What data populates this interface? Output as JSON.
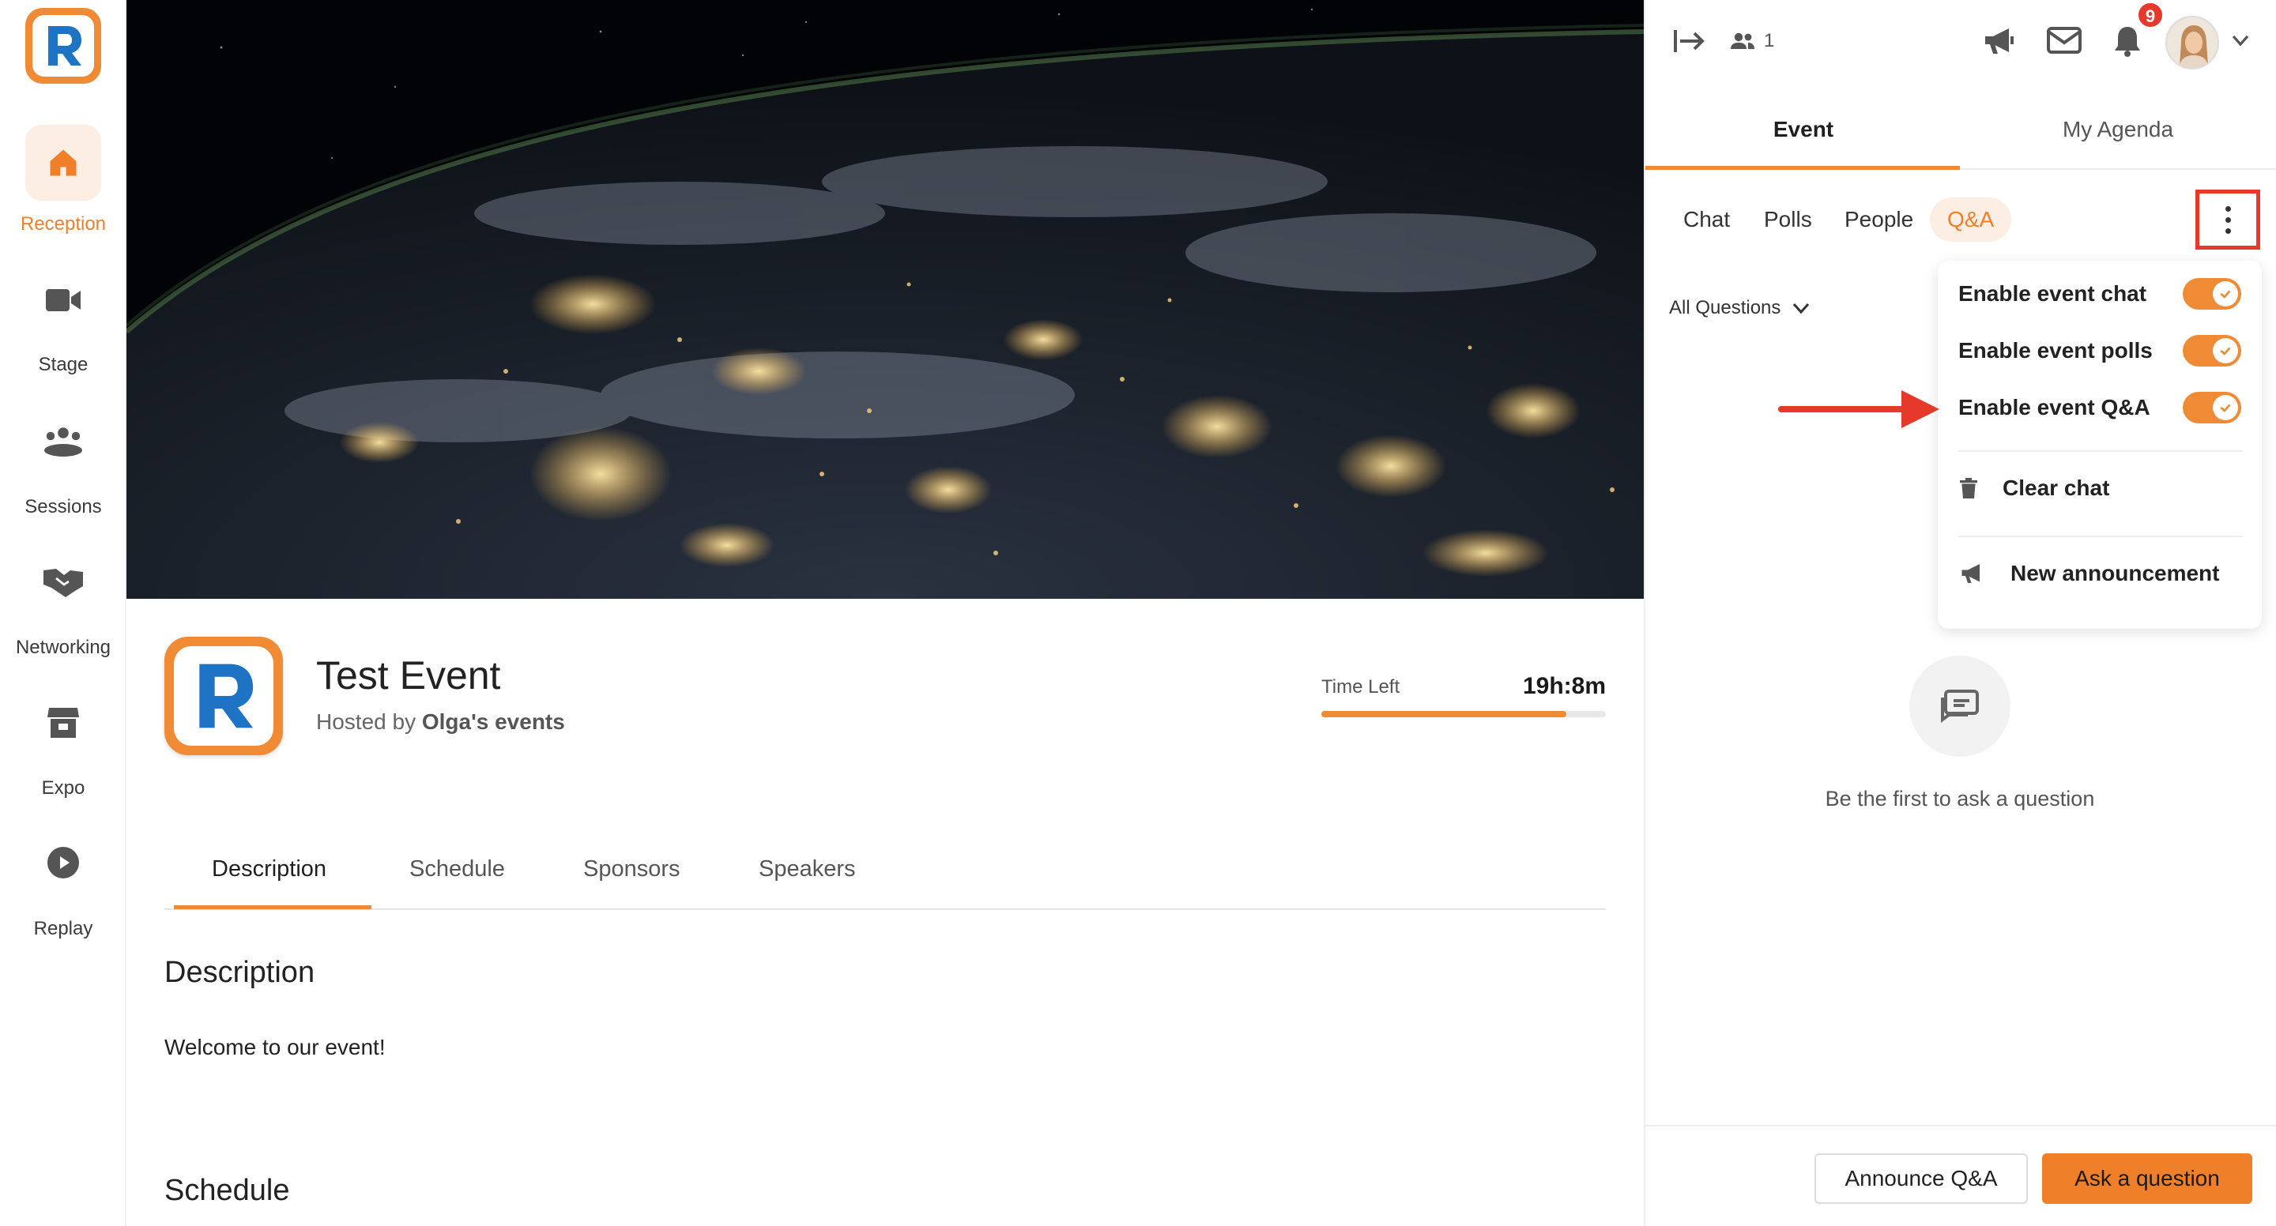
{
  "sidebar": {
    "items": [
      {
        "label": "Reception",
        "icon": "home-icon",
        "active": true
      },
      {
        "label": "Stage",
        "icon": "video-camera-icon"
      },
      {
        "label": "Sessions",
        "icon": "group-icon"
      },
      {
        "label": "Networking",
        "icon": "handshake-icon"
      },
      {
        "label": "Expo",
        "icon": "storefront-icon"
      },
      {
        "label": "Replay",
        "icon": "play-circle-icon"
      }
    ]
  },
  "event": {
    "title": "Test Event",
    "hosted_by": "Hosted by",
    "host_name": "Olga's events",
    "time_left_label": "Time Left",
    "time_left_value": "19h:8m",
    "time_left_progress": 0.86
  },
  "tabs": [
    "Description",
    "Schedule",
    "Sponsors",
    "Speakers"
  ],
  "content": {
    "description_heading": "Description",
    "description_text": "Welcome to our event!",
    "schedule_heading": "Schedule"
  },
  "panel": {
    "attendee_count": "1",
    "notification_count": "9",
    "tabs": [
      "Event",
      "My Agenda"
    ],
    "subtabs": [
      "Chat",
      "Polls",
      "People",
      "Q&A"
    ],
    "filter_label": "All Questions",
    "menu": {
      "toggles": [
        {
          "label": "Enable event chat",
          "on": true
        },
        {
          "label": "Enable event polls",
          "on": true
        },
        {
          "label": "Enable event Q&A",
          "on": true
        }
      ],
      "clear_chat": "Clear chat",
      "new_announcement": "New announcement"
    },
    "empty_state": "Be the first to ask a question",
    "buttons": {
      "announce": "Announce Q&A",
      "ask": "Ask a question"
    }
  },
  "colors": {
    "accent": "#f08a35",
    "highlight_red": "#e5392b"
  }
}
